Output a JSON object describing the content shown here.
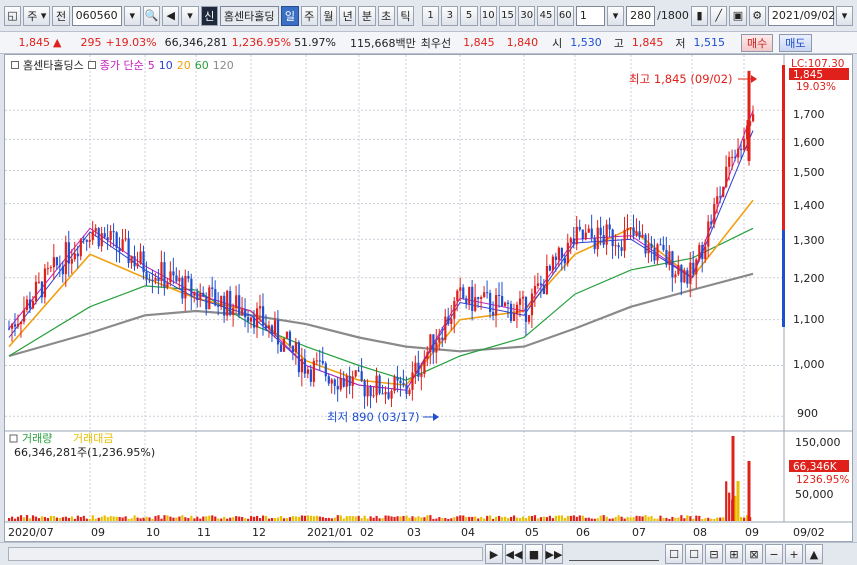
{
  "toolbar": {
    "market_sel": "주",
    "prev_btn": "전",
    "code": "060560",
    "xin": "신",
    "stock_name": "홈센타홀딩",
    "periods": [
      "일",
      "주",
      "월",
      "년",
      "분",
      "초",
      "틱"
    ],
    "numbers": [
      "1",
      "3",
      "5",
      "10",
      "15",
      "30",
      "45",
      "60"
    ],
    "step": "1",
    "count": "280",
    "total": "/1800",
    "date": "2021/09/02"
  },
  "quote": {
    "price": "1,845",
    "up_arrow": "▲",
    "change": "295",
    "change_pct": "+19.03%",
    "volume": "66,346,281",
    "volume_pct": "1,236.95%",
    "rate": "51.97%",
    "amount": "115,668백만",
    "priority_label": "최우선",
    "ask": "1,845",
    "bid": "1,840",
    "open_label": "시",
    "open": "1,530",
    "high_label": "고",
    "high": "1,845",
    "low_label": "저",
    "low": "1,515",
    "buy": "매수",
    "sell": "매도"
  },
  "legend": {
    "name": "홈센타홀딩스",
    "ma_label": "종가 단순",
    "ma5": "5",
    "ma10": "10",
    "ma20": "20",
    "ma60": "60",
    "ma120": "120"
  },
  "annotations": {
    "high": "최고 1,845 (09/02)",
    "low": "최저 890 (03/17)",
    "lc": "LC:107.30",
    "last_price": "1,845",
    "last_pct": "19.03%"
  },
  "price_axis": [
    "1,700",
    "1,600",
    "1,500",
    "1,400",
    "1,300",
    "1,200",
    "1,100",
    "1,000",
    "900"
  ],
  "volume_legend": {
    "vol": "거래량",
    "amt": "거래대금",
    "value": "66,346,281주(1,236.95%)"
  },
  "volume_axis": [
    "150,000",
    "100,000",
    "50,000"
  ],
  "volume_last": {
    "value": "66,346K",
    "pct": "1236.95%"
  },
  "x_axis": [
    "2020/07",
    "09",
    "10",
    "11",
    "12",
    "2021/01",
    "02",
    "03",
    "04",
    "05",
    "06",
    "07",
    "08",
    "09",
    "09/02"
  ],
  "colors": {
    "up": "#e0201a",
    "down": "#1f4fd0",
    "ma5": "#c21fc2",
    "ma10": "#2b3fd6",
    "ma20": "#f0a010",
    "ma60": "#26a03c",
    "ma120": "#8a8a8a"
  },
  "chart_data": {
    "type": "candlestick",
    "ylim": [
      880,
      1860
    ],
    "series": [
      {
        "name": "5",
        "x": [
          "2020/07",
          "09",
          "10",
          "11",
          "12",
          "2021/01",
          "02",
          "03",
          "04",
          "05",
          "06",
          "07",
          "08",
          "09"
        ],
        "values": [
          1080,
          1330,
          1230,
          1160,
          1120,
          1000,
          960,
          950,
          1150,
          1120,
          1300,
          1310,
          1200,
          1700
        ]
      },
      {
        "name": "10",
        "x": [
          "2020/07",
          "09",
          "10",
          "11",
          "12",
          "2021/01",
          "02",
          "03",
          "04",
          "05",
          "06",
          "07",
          "08",
          "09"
        ],
        "values": [
          1060,
          1320,
          1220,
          1150,
          1110,
          1000,
          960,
          950,
          1140,
          1110,
          1290,
          1300,
          1200,
          1630
        ]
      },
      {
        "name": "20",
        "x": [
          "2020/07",
          "09",
          "10",
          "11",
          "12",
          "2021/01",
          "02",
          "03",
          "04",
          "05",
          "06",
          "07",
          "08",
          "09"
        ],
        "values": [
          1040,
          1260,
          1200,
          1150,
          1120,
          1010,
          970,
          960,
          1100,
          1120,
          1260,
          1330,
          1200,
          1410
        ]
      },
      {
        "name": "60",
        "x": [
          "2020/07",
          "09",
          "10",
          "11",
          "12",
          "2021/01",
          "02",
          "03",
          "04",
          "05",
          "06",
          "07",
          "08",
          "09"
        ],
        "values": [
          1020,
          1130,
          1180,
          1170,
          1090,
          1040,
          1000,
          970,
          1020,
          1060,
          1160,
          1220,
          1250,
          1330
        ]
      },
      {
        "name": "120",
        "x": [
          "2020/07",
          "09",
          "10",
          "11",
          "12",
          "2021/01",
          "02",
          "03",
          "04",
          "05",
          "06",
          "07",
          "08",
          "09"
        ],
        "values": [
          1020,
          1070,
          1110,
          1120,
          1110,
          1090,
          1060,
          1040,
          1030,
          1040,
          1080,
          1130,
          1170,
          1210
        ]
      }
    ],
    "high": {
      "value": 1845,
      "date": "09/02"
    },
    "low": {
      "value": 890,
      "date": "03/17"
    }
  }
}
